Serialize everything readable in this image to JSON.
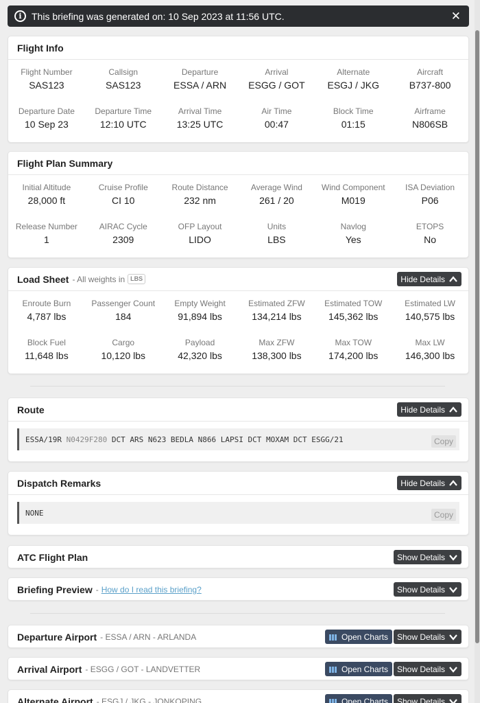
{
  "banner": {
    "text": "This briefing was generated on: 10 Sep 2023 at 11:56 UTC."
  },
  "flight_info": {
    "title": "Flight Info",
    "fields": [
      {
        "label": "Flight Number",
        "value": "SAS123"
      },
      {
        "label": "Callsign",
        "value": "SAS123"
      },
      {
        "label": "Departure",
        "value": "ESSA / ARN"
      },
      {
        "label": "Arrival",
        "value": "ESGG / GOT"
      },
      {
        "label": "Alternate",
        "value": "ESGJ / JKG"
      },
      {
        "label": "Aircraft",
        "value": "B737-800"
      },
      {
        "label": "Departure Date",
        "value": "10 Sep 23"
      },
      {
        "label": "Departure Time",
        "value": "12:10 UTC"
      },
      {
        "label": "Arrival Time",
        "value": "13:25 UTC"
      },
      {
        "label": "Air Time",
        "value": "00:47"
      },
      {
        "label": "Block Time",
        "value": "01:15"
      },
      {
        "label": "Airframe",
        "value": "N806SB"
      }
    ]
  },
  "flight_plan_summary": {
    "title": "Flight Plan Summary",
    "fields": [
      {
        "label": "Initial Altitude",
        "value": "28,000 ft"
      },
      {
        "label": "Cruise Profile",
        "value": "CI 10"
      },
      {
        "label": "Route Distance",
        "value": "232 nm"
      },
      {
        "label": "Average Wind",
        "value": "261 / 20"
      },
      {
        "label": "Wind Component",
        "value": "M019"
      },
      {
        "label": "ISA Deviation",
        "value": "P06"
      },
      {
        "label": "Release Number",
        "value": "1"
      },
      {
        "label": "AIRAC Cycle",
        "value": "2309"
      },
      {
        "label": "OFP Layout",
        "value": "LIDO"
      },
      {
        "label": "Units",
        "value": "LBS"
      },
      {
        "label": "Navlog",
        "value": "Yes"
      },
      {
        "label": "ETOPS",
        "value": "No"
      }
    ]
  },
  "load_sheet": {
    "title": "Load Sheet",
    "subtitle": "- All weights in",
    "unit": "LBS",
    "toggle": "Hide Details",
    "fields": [
      {
        "label": "Enroute Burn",
        "value": "4,787 lbs"
      },
      {
        "label": "Passenger Count",
        "value": "184"
      },
      {
        "label": "Empty Weight",
        "value": "91,894 lbs"
      },
      {
        "label": "Estimated ZFW",
        "value": "134,214 lbs"
      },
      {
        "label": "Estimated TOW",
        "value": "145,362 lbs"
      },
      {
        "label": "Estimated LW",
        "value": "140,575 lbs"
      },
      {
        "label": "Block Fuel",
        "value": "11,648 lbs"
      },
      {
        "label": "Cargo",
        "value": "10,120 lbs"
      },
      {
        "label": "Payload",
        "value": "42,320 lbs"
      },
      {
        "label": "Max ZFW",
        "value": "138,300 lbs"
      },
      {
        "label": "Max TOW",
        "value": "174,200 lbs"
      },
      {
        "label": "Max LW",
        "value": "146,300 lbs"
      }
    ]
  },
  "route": {
    "title": "Route",
    "toggle": "Hide Details",
    "text_start": "ESSA/19R",
    "text_dim": "N0429F280",
    "text_end": "DCT ARS N623 BEDLA N866 LAPSI DCT MOXAM DCT ESGG/21",
    "copy": "Copy"
  },
  "dispatch_remarks": {
    "title": "Dispatch Remarks",
    "toggle": "Hide Details",
    "text": "NONE",
    "copy": "Copy"
  },
  "atc_flight_plan": {
    "title": "ATC Flight Plan",
    "toggle": "Show Details"
  },
  "briefing_preview": {
    "title": "Briefing Preview",
    "dash": "-",
    "link": "How do I read this briefing?",
    "toggle": "Show Details"
  },
  "departure_airport": {
    "title": "Departure Airport",
    "subtitle": "- ESSA / ARN - ARLANDA",
    "charts": "Open Charts",
    "toggle": "Show Details"
  },
  "arrival_airport": {
    "title": "Arrival Airport",
    "subtitle": "- ESGG / GOT - LANDVETTER",
    "charts": "Open Charts",
    "toggle": "Show Details"
  },
  "alternate_airport": {
    "title": "Alternate Airport",
    "subtitle": "- ESGJ / JKG - JONKOPING",
    "charts": "Open Charts",
    "toggle": "Show Details"
  }
}
